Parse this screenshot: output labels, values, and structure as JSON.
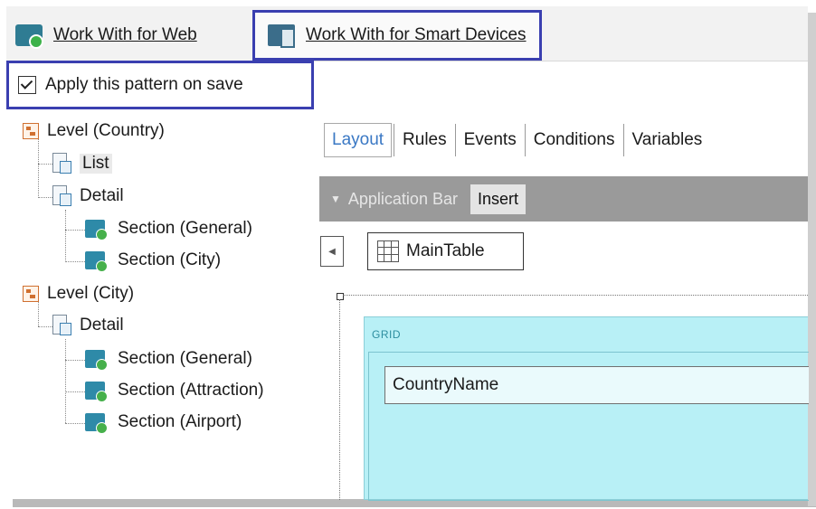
{
  "tabs": {
    "web_label": "Work With for Web",
    "smart_devices_label": "Work With for Smart Devices"
  },
  "apply_pattern": {
    "label": "Apply this pattern on save",
    "checked": true
  },
  "tree": {
    "level_country": "Level (Country)",
    "list": "List",
    "detail_country": "Detail",
    "section_general_country": "Section (General)",
    "section_city": "Section (City)",
    "level_city": "Level (City)",
    "detail_city": "Detail",
    "section_general_city": "Section (General)",
    "section_attraction": "Section (Attraction)",
    "section_airport": "Section (Airport)"
  },
  "editor": {
    "tabs": [
      "Layout",
      "Rules",
      "Events",
      "Conditions",
      "Variables"
    ],
    "active_tab": "Layout",
    "app_bar_title": "Application Bar",
    "insert_label": "Insert",
    "main_table_label": "MainTable",
    "grid_label": "GRID",
    "field_value": "CountryName"
  },
  "colors": {
    "highlight_border": "#3a3fb0",
    "grid_background": "#b8f0f6",
    "active_tab_text": "#3a78c4",
    "app_bar_background": "#9a9a9a"
  }
}
